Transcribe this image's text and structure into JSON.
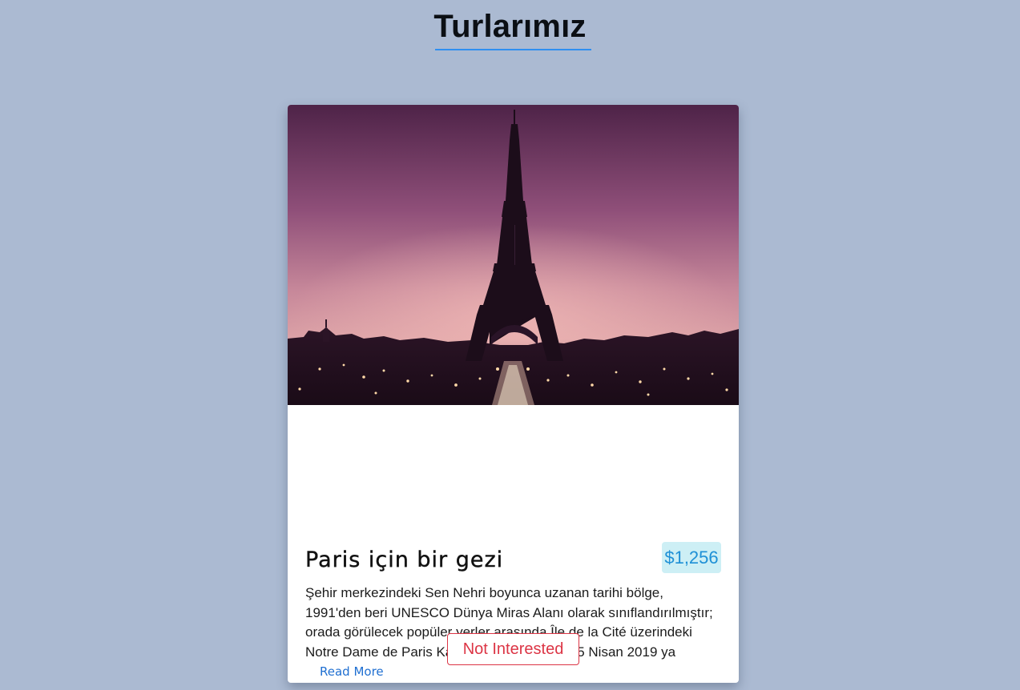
{
  "page": {
    "title": "Turlarımız"
  },
  "tour": {
    "image_name": "eiffel-tower-night-photo",
    "title": "Paris için bir gezi",
    "price": "$1,256",
    "description": "Şehir merkezindeki Sen Nehri boyunca uzanan tarihi bölge, 1991'den beri UNESCO Dünya Miras Alanı olarak sınıflandırılmıştır; orada görülecek popüler yerler arasında Île de la Cité üzerindeki Notre Dame de Paris Katedrali vardır halen 15 Nisan 2019 ya",
    "read_more_label": "Read More",
    "not_interested_label": "Not Interested"
  },
  "colors": {
    "background": "#abbad2",
    "accent_underline": "#2f8ff0",
    "price_bg": "#cdeff5",
    "price_text": "#1e90d6",
    "link": "#1f6fd1",
    "danger": "#dc3545"
  }
}
